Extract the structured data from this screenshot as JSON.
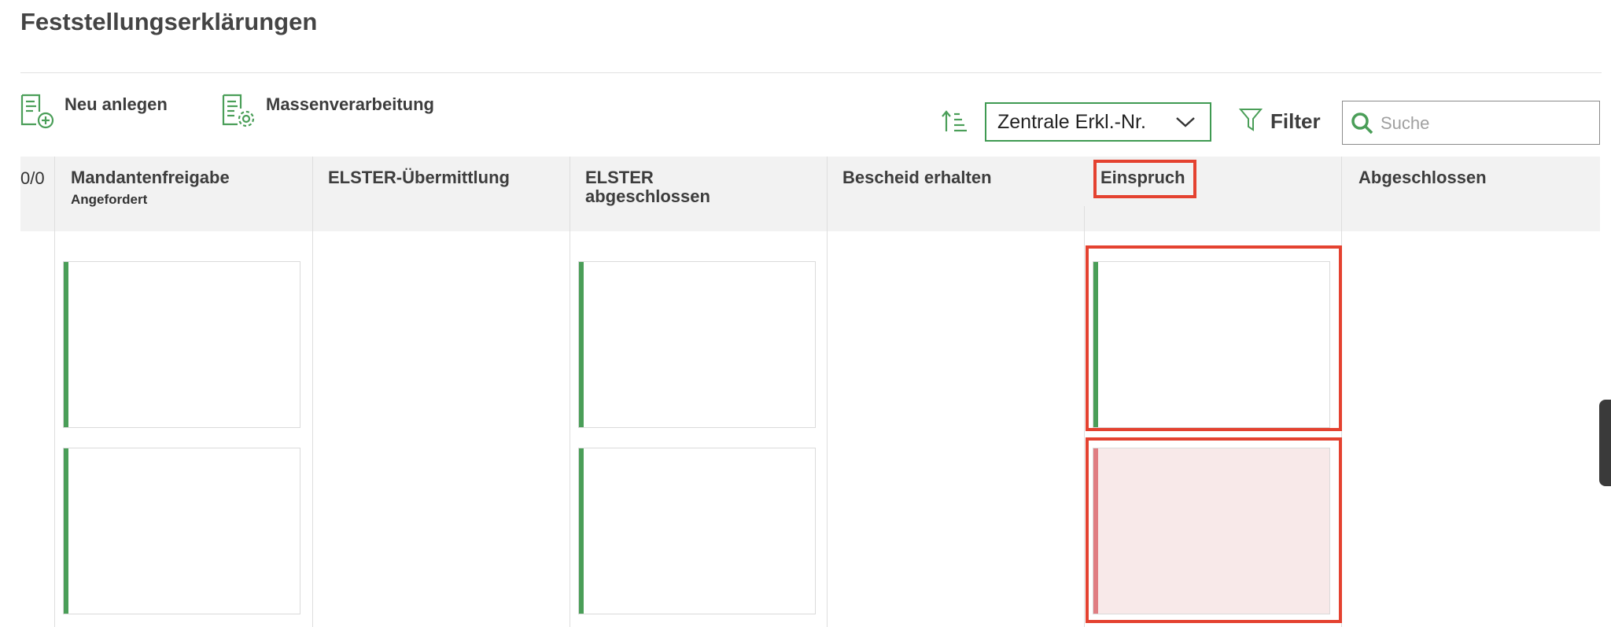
{
  "page": {
    "title": "Feststellungserklärungen"
  },
  "toolbar": {
    "new_label": "Neu anlegen",
    "bulk_label": "Massenverarbeitung",
    "sort_value": "Zentrale Erkl.-Nr.",
    "filter_label": "Filter",
    "search_placeholder": "Suche"
  },
  "table": {
    "count": "0/0",
    "columns": [
      {
        "label": "Mandantenfreigabe",
        "sublabel": "Angefordert"
      },
      {
        "label": "ELSTER-Übermittlung"
      },
      {
        "label": "ELSTER abgeschlossen"
      },
      {
        "label": "Bescheid erhalten"
      },
      {
        "label": "Einspruch"
      },
      {
        "label": "Abgeschlossen"
      }
    ]
  },
  "colors": {
    "accent_green": "#4a9e58",
    "highlight_red": "#e44230",
    "card_red_bg": "#f8e9e9"
  }
}
